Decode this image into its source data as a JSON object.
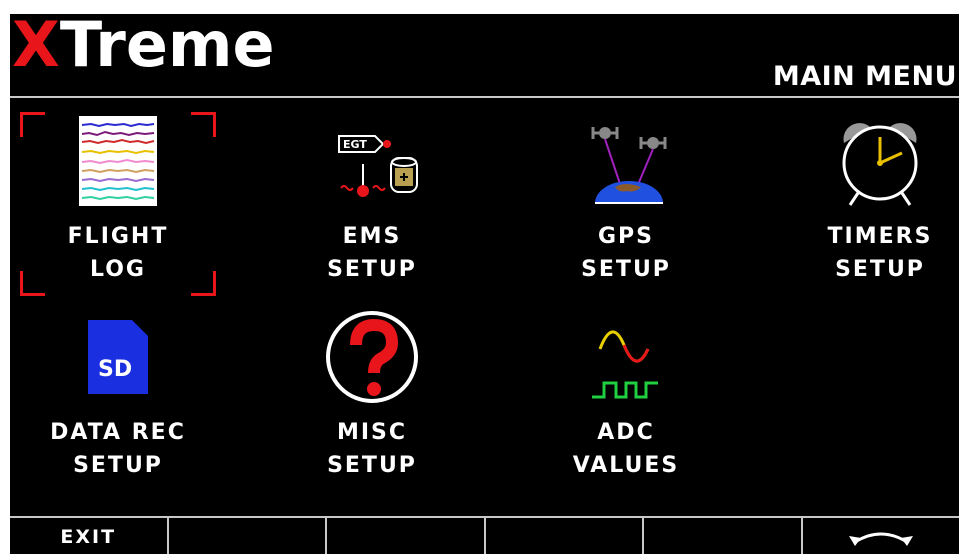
{
  "header": {
    "brand_x": "X",
    "brand_rest": "Treme",
    "title": "MAIN MENU"
  },
  "menu": [
    {
      "line1": "FLIGHT",
      "line2": "LOG",
      "icon": "flight-log-icon",
      "selected": true
    },
    {
      "line1": "EMS",
      "line2": "SETUP",
      "icon": "ems-icon"
    },
    {
      "line1": "GPS",
      "line2": "SETUP",
      "icon": "gps-icon"
    },
    {
      "line1": "TIMERS",
      "line2": "SETUP",
      "icon": "alarm-clock-icon"
    },
    {
      "line1": "DATA REC",
      "line2": "SETUP",
      "icon": "sd-card-icon"
    },
    {
      "line1": "MISC",
      "line2": "SETUP",
      "icon": "question-icon"
    },
    {
      "line1": "ADC",
      "line2": "VALUES",
      "icon": "waveform-icon"
    }
  ],
  "icons": {
    "egt_label": "EGT",
    "sd_label": "SD"
  },
  "footer": {
    "keys": [
      "EXIT",
      "",
      "",
      "",
      "",
      ""
    ],
    "last_icon": "rotate-arrows-icon"
  },
  "colors": {
    "background": "#000000",
    "accent": "#e8161a",
    "text": "#ffffff",
    "sd_blue": "#1a2fe0"
  }
}
